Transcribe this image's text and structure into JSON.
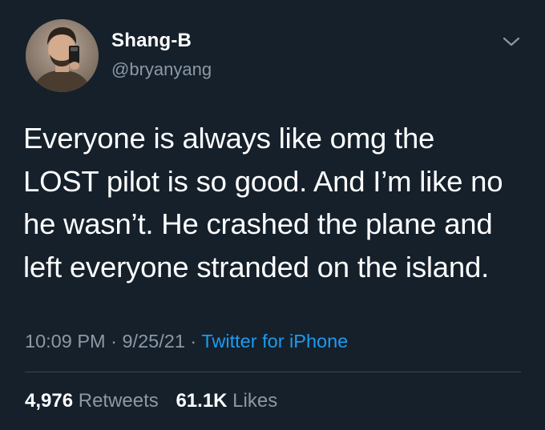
{
  "user": {
    "display_name": "Shang-B",
    "handle": "@bryanyang"
  },
  "tweet": {
    "lines": [
      "Everyone is always like omg the",
      "LOST pilot is so good. And I’m like no",
      "he wasn’t. He crashed the plane and",
      "left everyone stranded on the island."
    ]
  },
  "meta": {
    "time": "10:09 PM",
    "separator": "·",
    "date": "9/25/21",
    "source": "Twitter for iPhone"
  },
  "stats": {
    "retweets_count": "4,976",
    "retweets_label": "Retweets",
    "likes_count": "61.1K",
    "likes_label": "Likes"
  },
  "colors": {
    "background": "#15202b",
    "text_primary": "#ffffff",
    "text_secondary": "#8b98a5",
    "accent": "#1d9bf0",
    "divider": "#38444d"
  },
  "icons": {
    "chevron": "chevron-down-icon"
  }
}
